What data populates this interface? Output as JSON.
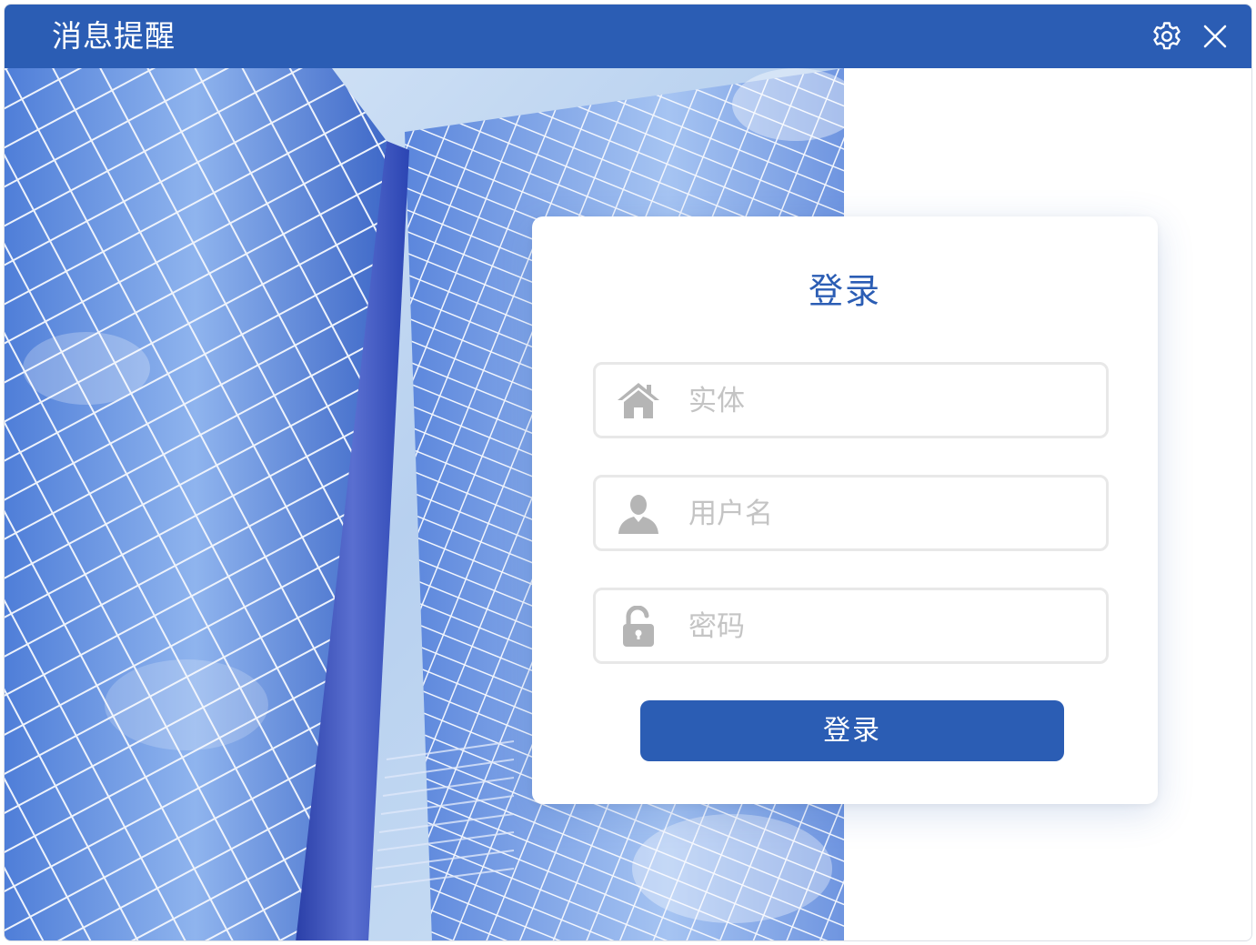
{
  "window": {
    "title": "消息提醒",
    "settings_icon": "gear-icon",
    "close_icon": "close-icon"
  },
  "login": {
    "heading": "登录",
    "entity_field": {
      "icon": "home-icon",
      "placeholder": "实体",
      "value": ""
    },
    "username_field": {
      "icon": "user-icon",
      "placeholder": "用户名",
      "value": ""
    },
    "password_field": {
      "icon": "unlock-icon",
      "placeholder": "密码",
      "value": ""
    },
    "submit_label": "登录"
  },
  "colors": {
    "brand": "#2b5db4",
    "field_border": "#e8e8e8",
    "placeholder": "#c4c4c4",
    "icon_gray": "#b5b5b5"
  }
}
